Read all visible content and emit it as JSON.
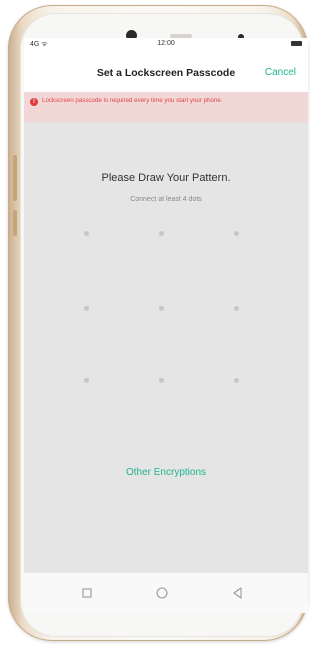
{
  "status_bar": {
    "signal_label": "4G ᯤ",
    "time": "12:00"
  },
  "header": {
    "title": "Set a Lockscreen Passcode",
    "cancel_label": "Cancel"
  },
  "banner": {
    "icon": "alert-icon",
    "text": "Lockscreen passcode is required every time you start your phone."
  },
  "pattern": {
    "prompt": "Please Draw Your Pattern.",
    "hint": "Connect at least 4 dots"
  },
  "other_encryptions_label": "Other Encryptions",
  "nav_bar": {
    "icons": [
      "square-icon",
      "circle-icon",
      "triangle-back-icon"
    ]
  },
  "colors": {
    "accent": "#1fb38e",
    "warning": "#e24545",
    "banner_bg": "#f2d7d7",
    "screen_bg": "#e5e5e5"
  }
}
